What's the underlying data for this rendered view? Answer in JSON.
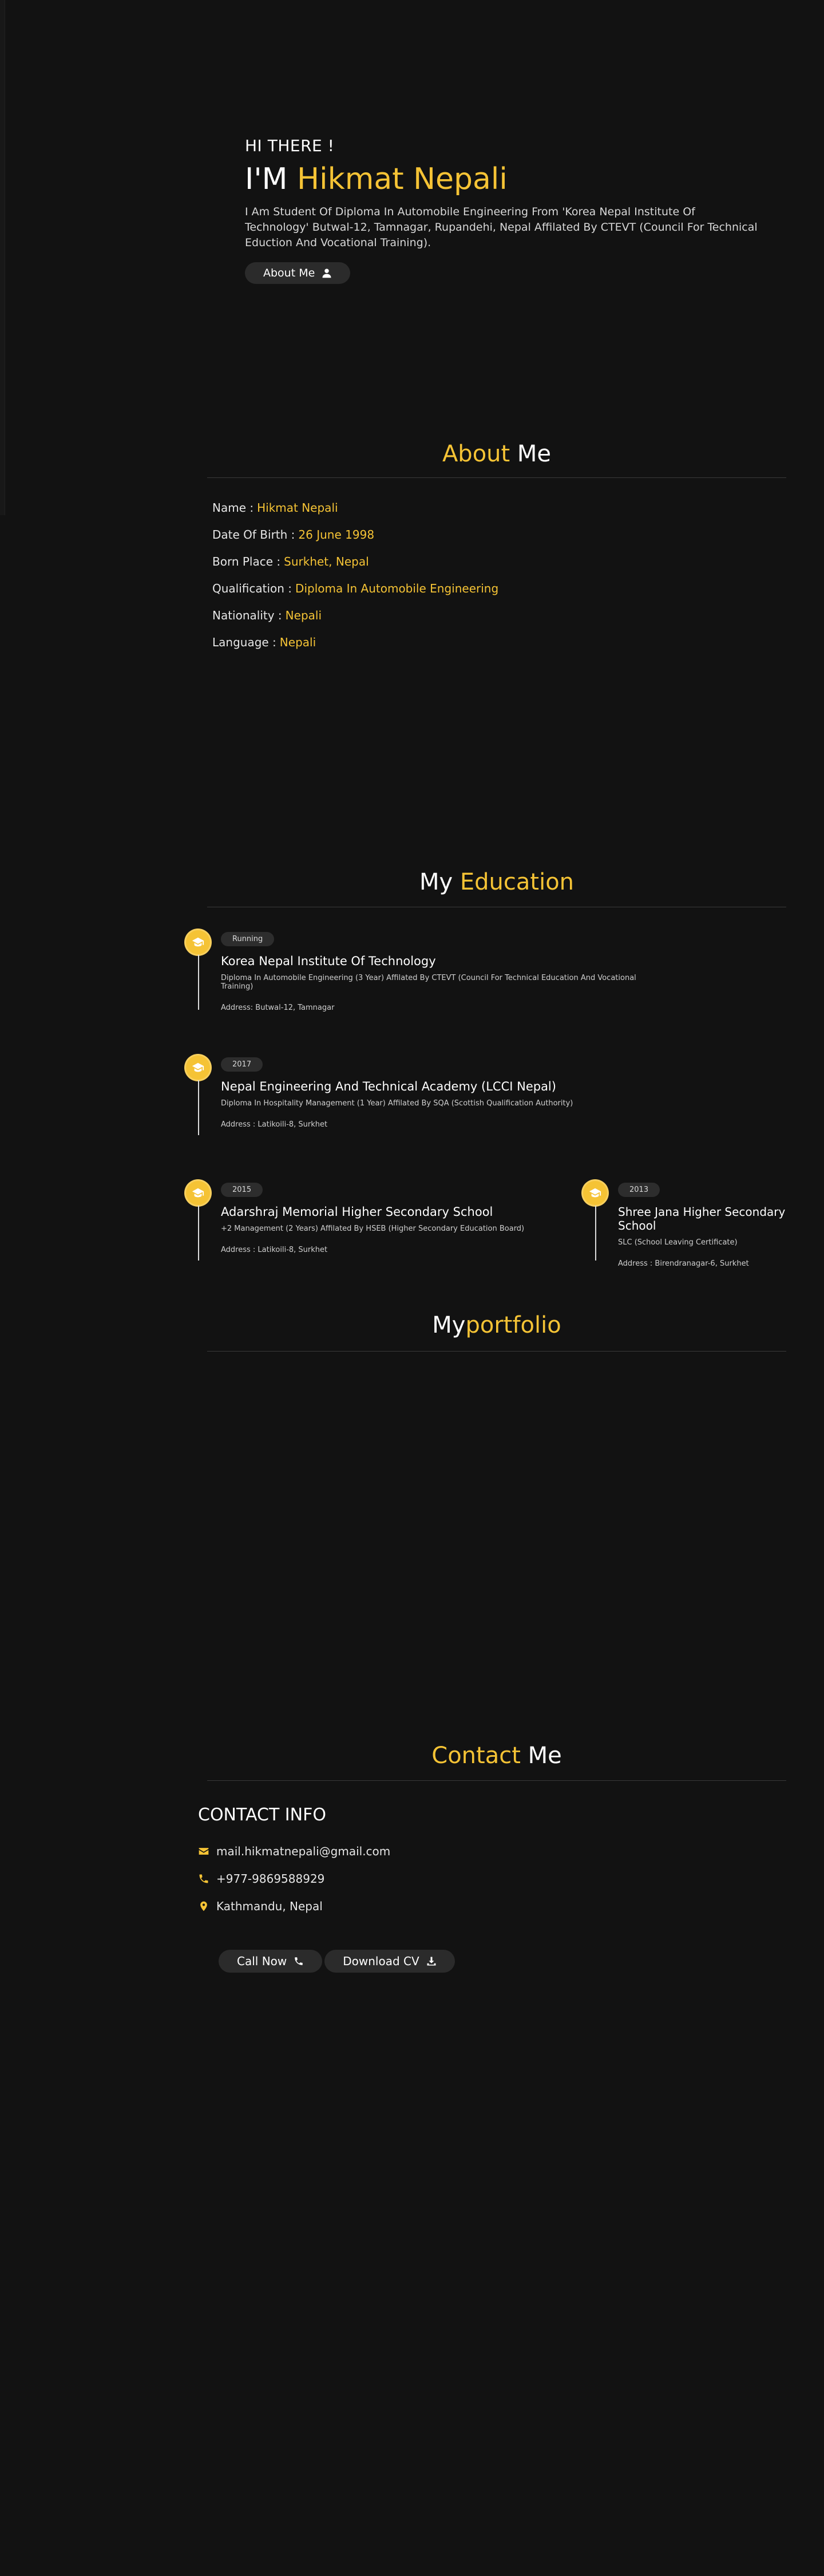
{
  "hero": {
    "greeting": "HI THERE !",
    "name_prefix": "I'M",
    "name": "Hikmat Nepali",
    "intro": "I Am Student Of Diploma In Automobile Engineering From 'Korea Nepal Institute Of Technology' Butwal-12, Tamnagar, Rupandehi, Nepal Affilated By CTEVT (Council For Technical Eduction And Vocational Training).",
    "button_label": "About Me",
    "button_icon": "user-icon"
  },
  "about": {
    "title_accent": "About",
    "title_rest": "Me",
    "rows": [
      {
        "label": "Name :",
        "value": "Hikmat Nepali"
      },
      {
        "label": "Date Of Birth :",
        "value": "26 June 1998"
      },
      {
        "label": "Born Place :",
        "value": "Surkhet, Nepal"
      },
      {
        "label": "Qualification :",
        "value": "Diploma In Automobile Engineering"
      },
      {
        "label": "Nationality :",
        "value": "Nepali"
      },
      {
        "label": "Language :",
        "value": "Nepali"
      }
    ]
  },
  "education": {
    "title_prefix": "My",
    "title_accent": "Education",
    "items": [
      {
        "badge": "Running",
        "title": "Korea Nepal Institute Of Technology",
        "desc": "Diploma In Automobile Engineering (3 Year) Affilated By CTEVT (Council For Technical Education And Vocational Training)",
        "address": "Address: Butwal-12, Tamnagar"
      },
      {
        "badge": "2017",
        "title": "Nepal Engineering And Technical Academy (LCCI Nepal)",
        "desc": "Diploma In Hospitality Management (1 Year) Affilated By SQA (Scottish Qualification Authority)",
        "address": "Address : Latikoili-8, Surkhet"
      },
      {
        "badge": "2015",
        "title": "Adarshraj Memorial Higher Secondary School",
        "desc": "+2 Management (2 Years) Affilated By HSEB (Higher Secondary Education Board)",
        "address": "Address : Latikoili-8, Surkhet"
      },
      {
        "badge": "2013",
        "title": "Shree Jana Higher Secondary School",
        "desc": "SLC (School Leaving Certificate)",
        "address": "Address : Birendranagar-6, Surkhet"
      }
    ]
  },
  "portfolio": {
    "title_prefix": "My",
    "title_accent": "portfolio"
  },
  "contact": {
    "title_accent": "Contact",
    "title_rest": "Me",
    "heading": "CONTACT INFO",
    "email": "mail.hikmatnepali@gmail.com",
    "phone": "+977-9869588929",
    "location": "Kathmandu, Nepal",
    "call_label": "Call Now",
    "cv_label": "Download CV"
  },
  "colors": {
    "background": "#121212",
    "accent": "#f5c335",
    "button": "#2b2b2b"
  }
}
